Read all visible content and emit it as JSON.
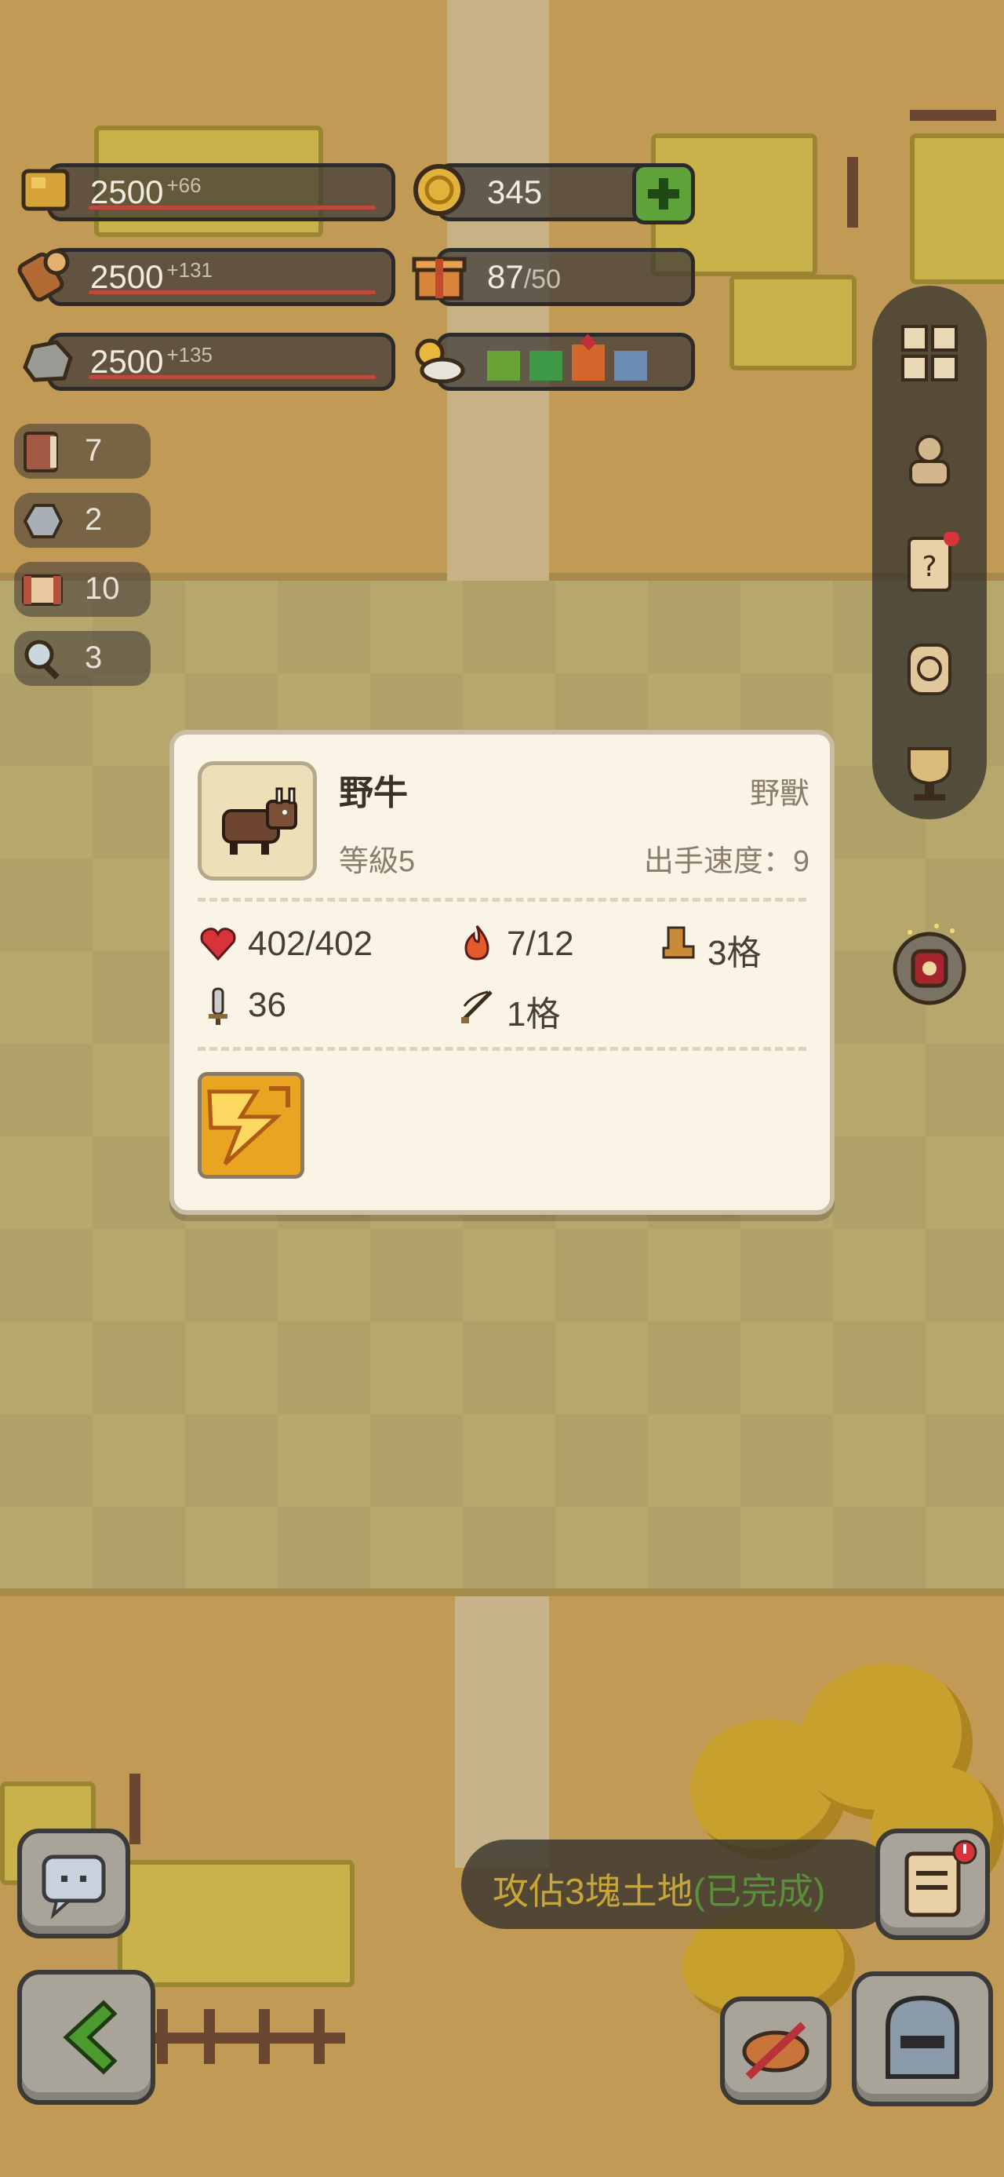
{
  "resources": {
    "wood": {
      "value": "2500",
      "plus": "+66",
      "icon": "wheat-icon"
    },
    "log": {
      "value": "2500",
      "plus": "+131",
      "icon": "log-icon"
    },
    "stone": {
      "value": "2500",
      "plus": "+135",
      "icon": "stone-icon"
    },
    "coin": {
      "value": "345",
      "icon": "coin-icon"
    },
    "gift": {
      "value": "87",
      "max": "/50",
      "icon": "gift-icon"
    },
    "weather": {
      "icon": "weather-icon",
      "colors": [
        "#6ba235",
        "#3f9a47",
        "#d2662b",
        "#6b8cb0"
      ]
    }
  },
  "side_counters": [
    {
      "icon": "book-icon",
      "count": "7"
    },
    {
      "icon": "ore-icon",
      "count": "2"
    },
    {
      "icon": "scroll-icon",
      "count": "10"
    },
    {
      "icon": "magnifier-icon",
      "count": "3"
    }
  ],
  "right_menu": [
    "grid-icon",
    "character-icon",
    "quest-scroll-icon",
    "target-icon",
    "trophy-icon"
  ],
  "popup": {
    "name": "野牛",
    "type": "野獸",
    "level": "等級5",
    "speed": "出手速度：9",
    "hp": "402/402",
    "fire": "7/12",
    "move": "3格",
    "attack": "36",
    "range": "1格"
  },
  "quest": {
    "text": "攻佔3塊土地",
    "status": "(已完成)"
  },
  "colors": {
    "popup_bg": "#faf4e6",
    "quest_text": "#c7a53a",
    "done": "#5b8f3a",
    "hp_red": "#d8333a"
  }
}
